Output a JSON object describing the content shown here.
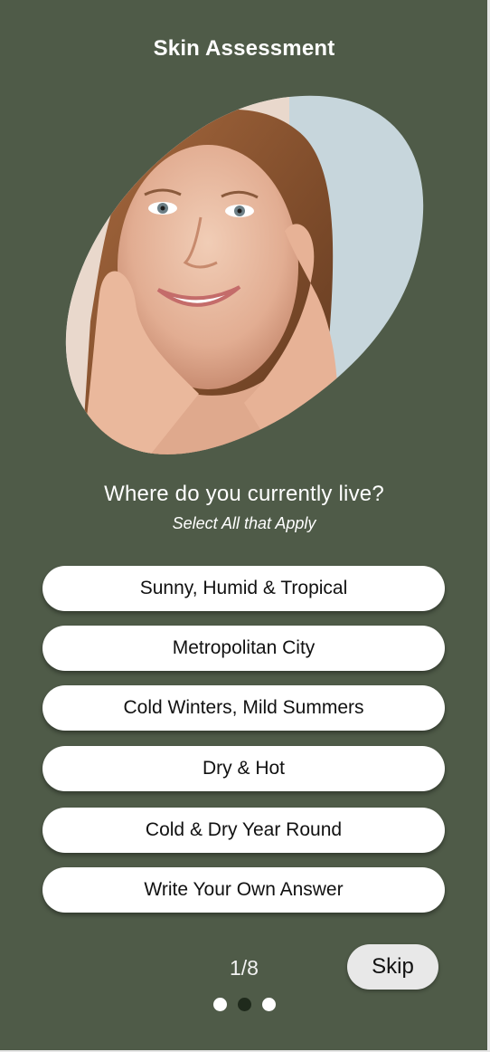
{
  "header": {
    "title": "Skin Assessment"
  },
  "hero": {
    "image": "smiling-woman-portrait"
  },
  "question": {
    "text": "Where do you currently live?",
    "hint": "Select All that Apply"
  },
  "options": [
    {
      "label": "Sunny, Humid & Tropical"
    },
    {
      "label": "Metropolitan City"
    },
    {
      "label": "Cold Winters, Mild Summers"
    },
    {
      "label": "Dry & Hot"
    },
    {
      "label": "Cold & Dry Year Round"
    },
    {
      "label": "Write Your Own Answer"
    }
  ],
  "footer": {
    "progress": "1/8",
    "skip_label": "Skip",
    "dots": 3,
    "active_dot": 2
  },
  "colors": {
    "background": "#4f5b48",
    "option_bg": "#ffffff",
    "skip_bg": "#e8e8e8",
    "active_dot": "#1f2a1c"
  }
}
